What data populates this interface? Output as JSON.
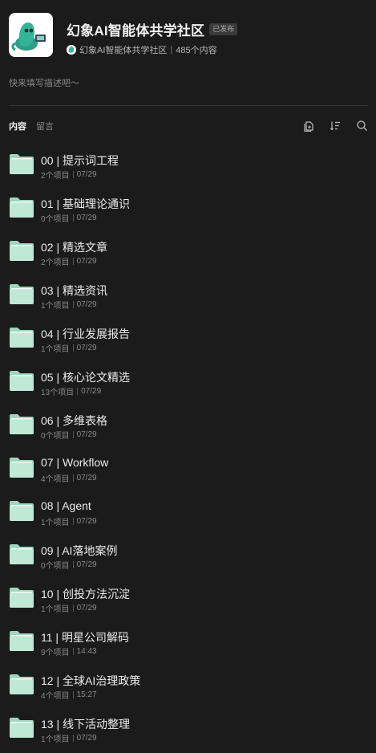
{
  "header": {
    "title": "幻象AI智能体共学社区",
    "badge": "已发布",
    "owner_name": "幻象AI智能体共学社区",
    "content_count": "485个内容",
    "description": "快来填写描述吧～"
  },
  "tabs": [
    {
      "label": "内容",
      "active": true
    },
    {
      "label": "留言",
      "active": false
    }
  ],
  "tools": [
    "add-icon",
    "sort-icon",
    "search-icon"
  ],
  "colors": {
    "background": "#1b1b1b",
    "folder": "#bfe8d5",
    "folder_dark": "#9fd6bd"
  },
  "items": [
    {
      "title": "00 | 提示词工程",
      "count": "2个项目",
      "date": "07/29"
    },
    {
      "title": "01 | 基础理论通识",
      "count": "0个项目",
      "date": "07/29"
    },
    {
      "title": "02 | 精选文章",
      "count": "2个项目",
      "date": "07/29"
    },
    {
      "title": "03 | 精选资讯",
      "count": "1个项目",
      "date": "07/29"
    },
    {
      "title": "04 | 行业发展报告",
      "count": "1个项目",
      "date": "07/29"
    },
    {
      "title": "05 | 核心论文精选",
      "count": "13个项目",
      "date": "07/29"
    },
    {
      "title": "06 | 多维表格",
      "count": "0个项目",
      "date": "07/29"
    },
    {
      "title": "07 | Workflow",
      "count": "4个项目",
      "date": "07/29"
    },
    {
      "title": "08 | Agent",
      "count": "1个项目",
      "date": "07/29"
    },
    {
      "title": "09 | AI落地案例",
      "count": "0个项目",
      "date": "07/29"
    },
    {
      "title": "10 | 创投方法沉淀",
      "count": "1个项目",
      "date": "07/29"
    },
    {
      "title": "11 | 明星公司解码",
      "count": "9个项目",
      "date": "14:43"
    },
    {
      "title": "12 | 全球AI治理政策",
      "count": "4个项目",
      "date": "15:27"
    },
    {
      "title": "13 | 线下活动整理",
      "count": "1个项目",
      "date": "07/29"
    }
  ]
}
